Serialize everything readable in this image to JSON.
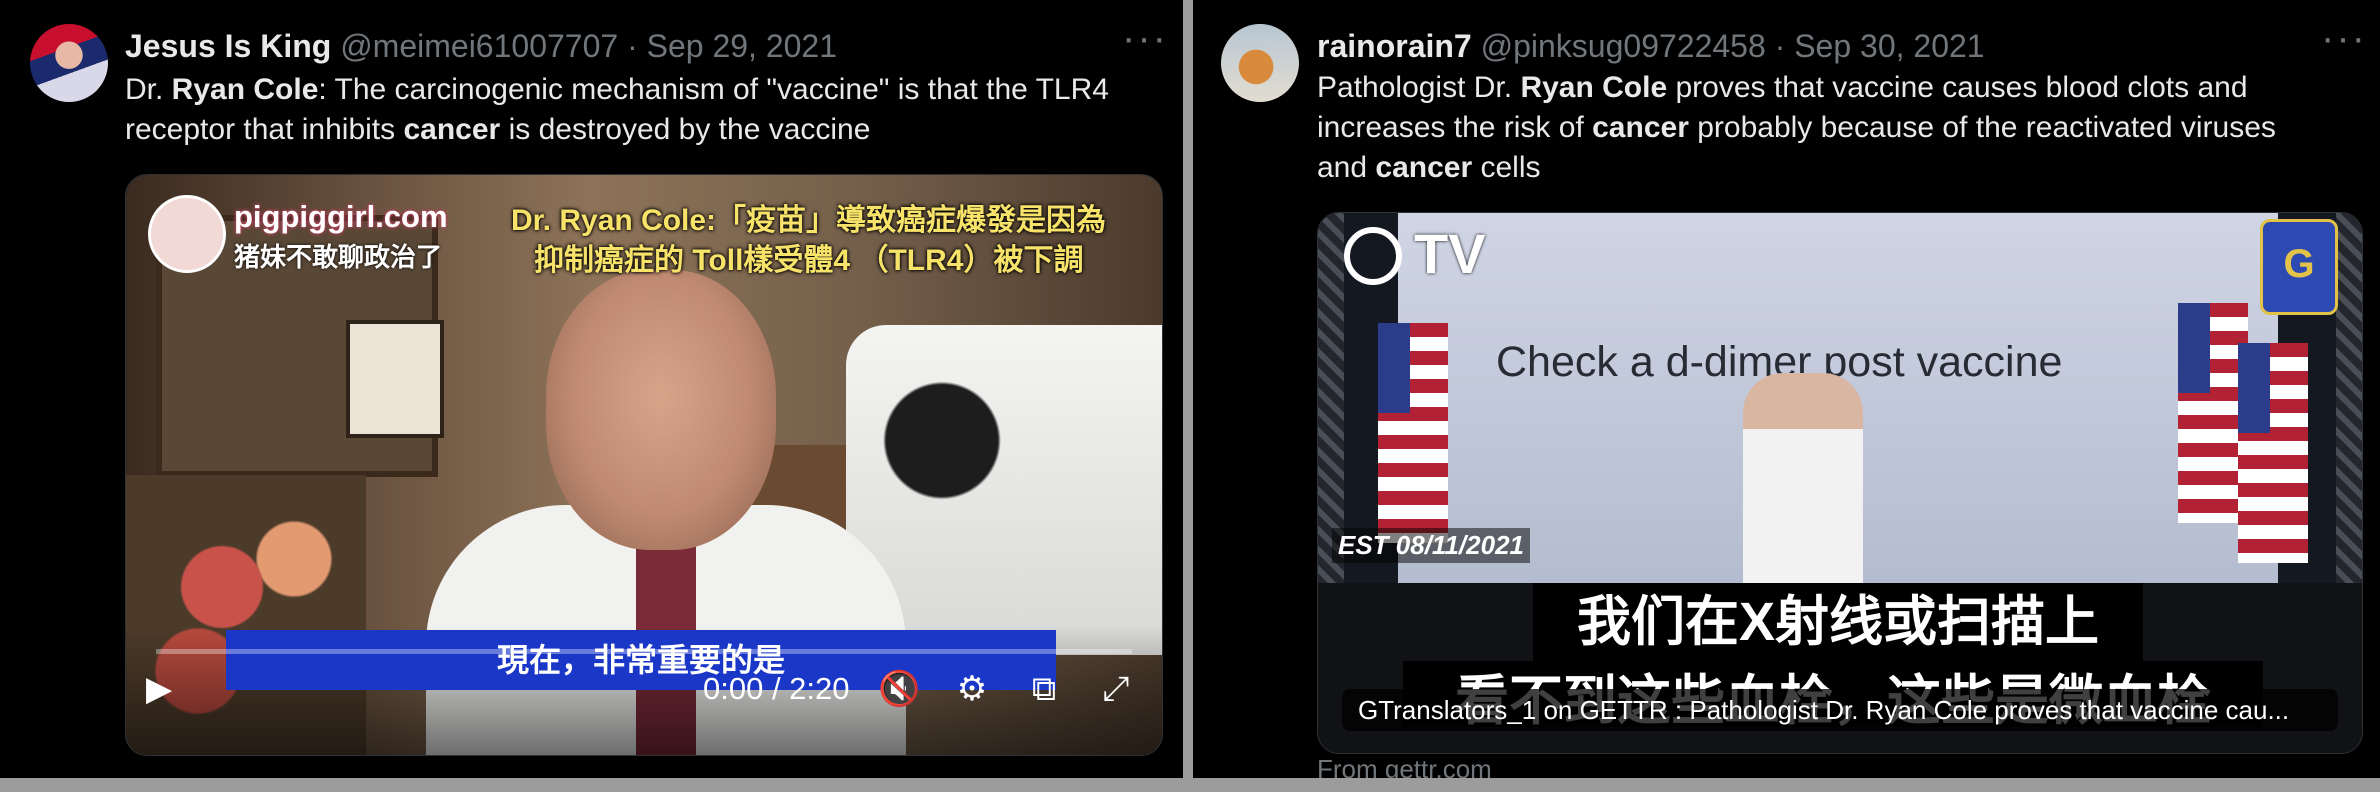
{
  "tweets": [
    {
      "display_name": "Jesus Is King",
      "handle": "@meimei61007707",
      "sep": "·",
      "date": "Sep 29, 2021",
      "more": "···",
      "text_parts": [
        "Dr. ",
        "Ryan Cole",
        ": The carcinogenic mechanism of \"vaccine\" is that the TLR4",
        "receptor that inhibits ",
        "cancer",
        " is destroyed by the vaccine"
      ],
      "media": {
        "watermark_site": "pigpiggirl.com",
        "watermark_sub": "猪妹不敢聊政治了",
        "caption_line1": "Dr. Ryan Cole:「疫苗」導致癌症爆發是因為",
        "caption_line2": "抑制癌症的 Toll樣受體4 （TLR4）被下調",
        "subtitle": "現在，非常重要的是",
        "time": "0:00 / 2:20",
        "progress": 0.0,
        "controls": {
          "play": "▶",
          "mute": "🔇",
          "settings": "⚙",
          "pip": "⧉",
          "fullscreen": "⤢"
        }
      }
    },
    {
      "display_name": "rainorain7",
      "handle": "@pinksug09722458",
      "sep": "·",
      "date": "Sep 30, 2021",
      "more": "···",
      "text_parts": [
        "Pathologist Dr. ",
        "Ryan Cole",
        " proves that vaccine causes blood clots and",
        "increases the risk of ",
        "cancer",
        " probably because of the reactivated viruses",
        "and ",
        "cancer",
        " cells"
      ],
      "media": {
        "brand": "TV",
        "badge": "G",
        "slide_text": "Check a d-dimer post vaccine",
        "est": "EST 08/11/2021",
        "subtitle_line1": "我们在X射线或扫描上",
        "subtitle_line2": "看不到这些血栓，这些是微血栓",
        "link_caption": "GTranslators_1 on GETTR : Pathologist Dr. Ryan Cole proves that vaccine cau..."
      },
      "source": "From gettr.com"
    }
  ],
  "colors": {
    "background": "#000000",
    "primary_text": "#e7e9ea",
    "secondary_text": "#71767b",
    "caption_yellow": "#f7e36a",
    "subtitle_blue": "#1a37c8"
  }
}
